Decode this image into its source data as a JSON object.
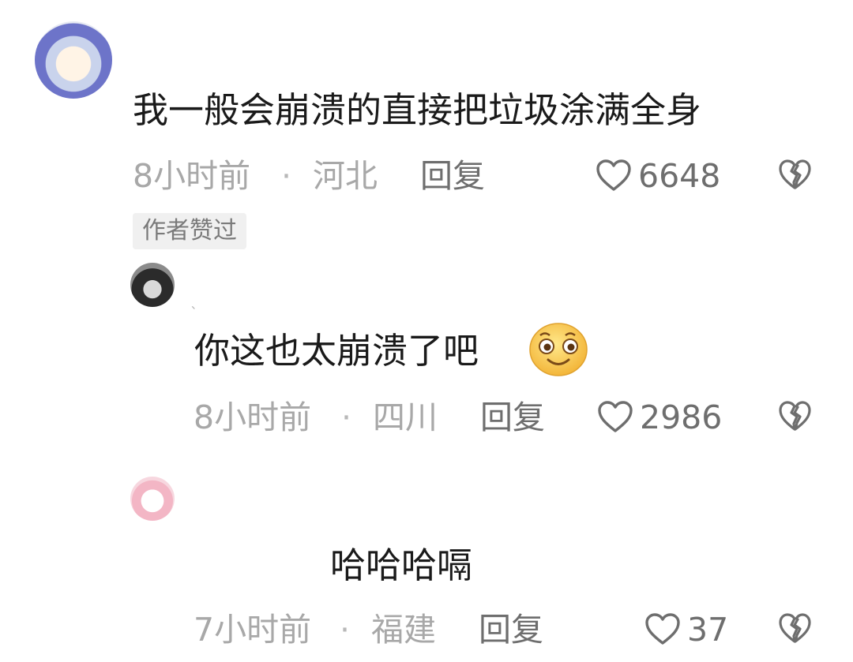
{
  "comments": [
    {
      "text": "我一般会崩溃的直接把垃圾涂满全身",
      "time": "8小时前",
      "location": "河北",
      "reply_label": "回复",
      "likes": "6648",
      "badge": "作者赞过"
    },
    {
      "username_fragment": "、",
      "text": "你这也太崩溃了吧",
      "emoji": "smirk-emoji",
      "time": "8小时前",
      "location": "四川",
      "reply_label": "回复",
      "likes": "2986"
    },
    {
      "text": "哈哈哈嗝",
      "time": "7小时前",
      "location": "福建",
      "reply_label": "回复",
      "likes": "37"
    }
  ],
  "separator": "·",
  "icons": {
    "like": "heart-outline-icon",
    "dislike": "broken-heart-icon"
  },
  "colors": {
    "text": "#1a1a1a",
    "meta": "#a8a8a8",
    "action": "#6e6e6e",
    "badge_bg": "#f0f0f0"
  }
}
